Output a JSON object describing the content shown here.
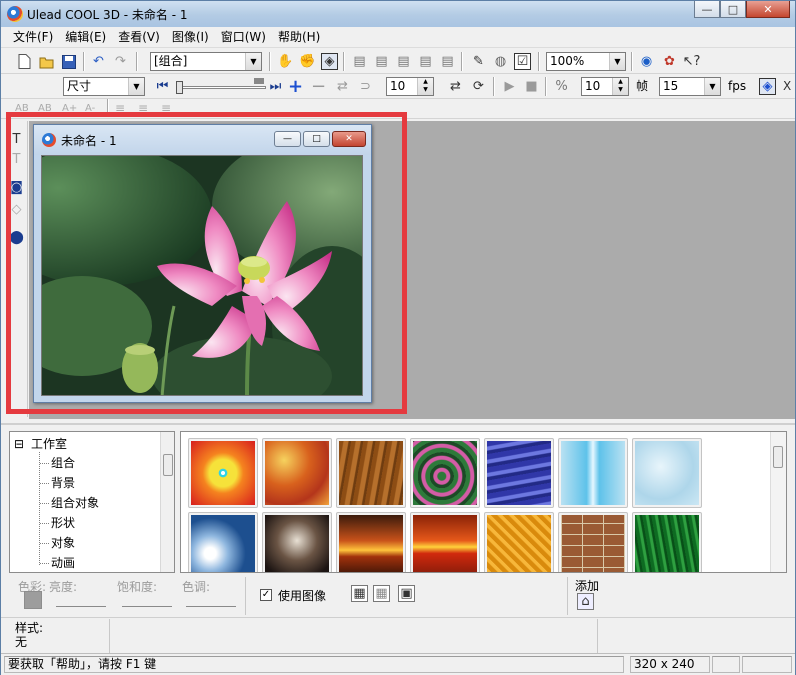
{
  "window": {
    "title": "Ulead COOL 3D - 未命名 - 1",
    "buttons": {
      "minimize": "—",
      "maximize": "□",
      "close": "✕"
    }
  },
  "menu": [
    "文件(F)",
    "编辑(E)",
    "查看(V)",
    "图像(I)",
    "窗口(W)",
    "帮助(H)"
  ],
  "toolbar1": {
    "object_combo": "[组合]",
    "zoom_combo": "100%"
  },
  "toolbar2": {
    "size_combo": "尺寸",
    "step_value": "10",
    "frame_value": "10",
    "frame_label": "帧",
    "fps_value": "15",
    "fps_label": "fps"
  },
  "toolbar3": {
    "text_tools": [
      "AB",
      "AB",
      "A+",
      "A-"
    ]
  },
  "document": {
    "title": "未命名 - 1",
    "buttons": {
      "minimize": "—",
      "maximize": "□",
      "close": "✕"
    },
    "image_subject": "pink lotus flower with seed pods on green leaves"
  },
  "tree": {
    "root": "工作室",
    "items": [
      "组合",
      "背景",
      "组合对象",
      "形状",
      "对象",
      "动画"
    ]
  },
  "thumbnails": [
    "rainbow sunburst",
    "orange marble",
    "brown wood grain",
    "green-pink swirl",
    "blue water ripples",
    "blue waterfall",
    "light blue ice",
    "blue sky clouds",
    "dusk clouds",
    "orange sunset",
    "red sea sunset",
    "golden weave",
    "brick wall",
    "green grass"
  ],
  "controls": {
    "color_label": "色彩:",
    "brightness_label": "亮度:",
    "saturation_label": "饱和度:",
    "hue_label": "色调:",
    "use_image_label": "使用图像",
    "use_image_checked": true,
    "add_label": "添加",
    "style_label": "样式:",
    "style_value": "无"
  },
  "statusbar": {
    "help_text": "要获取「帮助」，请按 F1 键",
    "dimensions": "320 x 240"
  },
  "colors": {
    "highlight_box": "#e53a3f",
    "workspace": "#ababab"
  }
}
